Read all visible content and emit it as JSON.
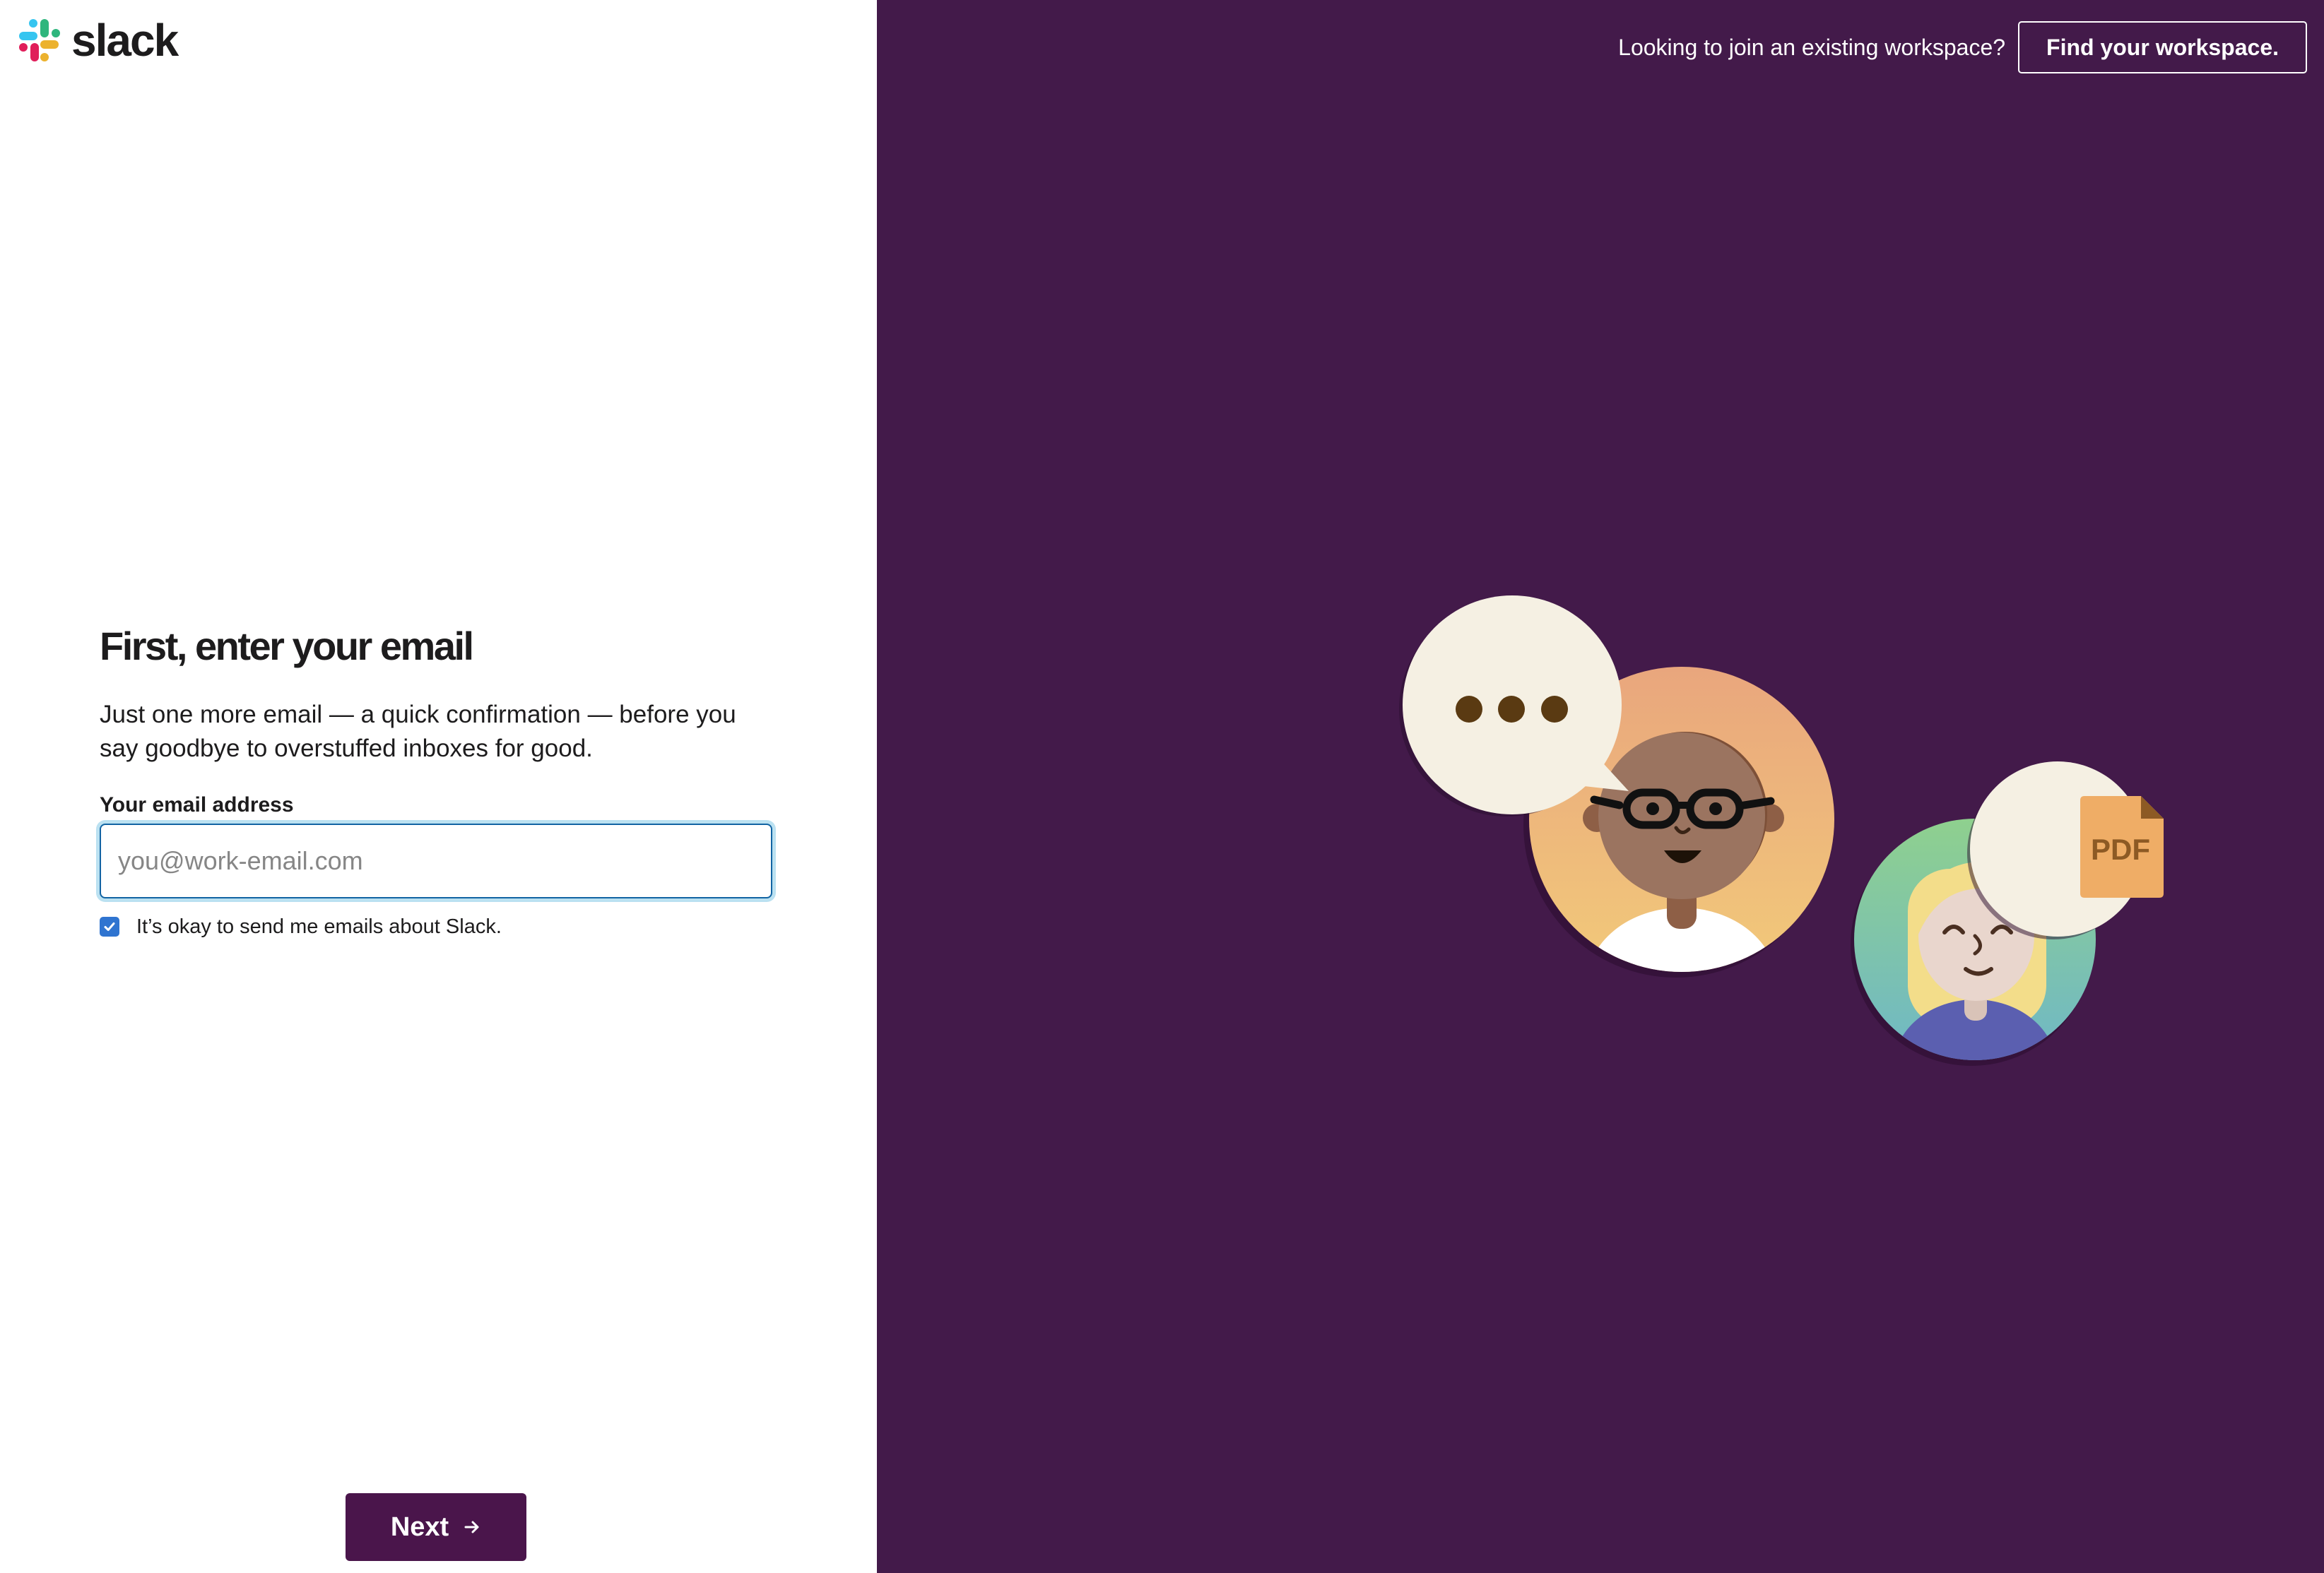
{
  "brand": {
    "name": "slack",
    "colors": {
      "aubergine": "#4a154b",
      "panel": "#431a4a",
      "focus_blue": "#1264a3",
      "checkbox_blue": "#2f74d0"
    }
  },
  "header": {
    "join_prompt": "Looking to join an existing workspace?",
    "find_button": "Find your workspace."
  },
  "form": {
    "heading": "First, enter your email",
    "subtext": "Just one more email — a quick confirmation — before you say goodbye to overstuffed inboxes for good.",
    "email_label": "Your email address",
    "email_placeholder": "you@work-email.com",
    "email_value": "",
    "marketing_checkbox_label": "It’s okay to send me emails about Slack.",
    "marketing_checkbox_checked": true
  },
  "footer": {
    "next_label": "Next"
  },
  "illustration": {
    "typing_bubble_icon": "ellipsis-icon",
    "file_bubble_label": "PDF"
  }
}
